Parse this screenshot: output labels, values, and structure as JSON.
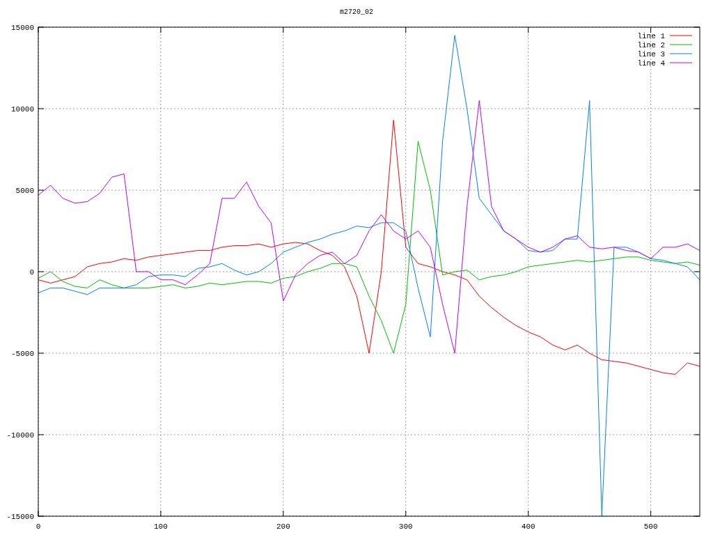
{
  "chart": {
    "chart_data": {
      "type": "line",
      "title": "m2720_02",
      "x": [
        0,
        10,
        20,
        30,
        40,
        50,
        60,
        70,
        80,
        90,
        100,
        110,
        120,
        130,
        140,
        150,
        160,
        170,
        180,
        190,
        200,
        210,
        220,
        230,
        240,
        250,
        260,
        270,
        280,
        290,
        300,
        310,
        320,
        330,
        340,
        350,
        360,
        370,
        380,
        390,
        400,
        410,
        420,
        430,
        440,
        450,
        460,
        470,
        480,
        490,
        500,
        510,
        520,
        530,
        540
      ],
      "series": [
        {
          "name": "line 1",
          "color": "#ff0000",
          "values": [
            -500,
            -700,
            -500,
            -300,
            300,
            500,
            600,
            800,
            700,
            900,
            1000,
            1100,
            1200,
            1300,
            1300,
            1500,
            1600,
            1600,
            1700,
            1500,
            1700,
            1800,
            1700,
            1300,
            1000,
            300,
            -1500,
            -5000,
            0,
            9300,
            1500,
            500,
            300,
            0,
            -200,
            -500,
            -1500,
            -2200,
            -2800,
            -3300,
            -3700,
            -4000,
            -4500,
            -4800,
            -4500,
            -5000,
            -5400,
            -5500,
            -5600,
            -5800,
            -6000,
            -6200,
            -6300,
            -5600,
            -5800
          ]
        },
        {
          "name": "line 2",
          "color": "#00c000",
          "values": [
            -400,
            0,
            -600,
            -900,
            -1000,
            -500,
            -800,
            -1000,
            -1000,
            -1000,
            -900,
            -800,
            -1000,
            -900,
            -700,
            -800,
            -700,
            -600,
            -600,
            -700,
            -400,
            -300,
            0,
            200,
            500,
            500,
            300,
            -1500,
            -3000,
            -5000,
            -2000,
            8000,
            5000,
            -200,
            0,
            100,
            -500,
            -300,
            -200,
            0,
            300,
            400,
            500,
            600,
            700,
            600,
            700,
            800,
            900,
            900,
            700,
            600,
            500,
            600,
            400
          ]
        },
        {
          "name": "line 3",
          "color": "#0080ff",
          "values": [
            -1300,
            -1000,
            -1000,
            -1200,
            -1400,
            -1000,
            -1000,
            -1000,
            -800,
            -300,
            -200,
            -200,
            -300,
            200,
            300,
            500,
            100,
            -200,
            0,
            500,
            1200,
            1500,
            1800,
            2000,
            2300,
            2500,
            2800,
            2700,
            3000,
            3000,
            2500,
            -1000,
            -4000,
            8000,
            14500,
            10000,
            4500,
            3500,
            2500,
            2000,
            1300,
            1200,
            1300,
            2000,
            2000,
            10500,
            -15000,
            1500,
            1500,
            1200,
            800,
            700,
            500,
            300,
            -500
          ]
        },
        {
          "name": "line 4",
          "color": "#c000ff",
          "values": [
            4700,
            5300,
            4500,
            4200,
            4300,
            4800,
            5800,
            6000,
            0,
            0,
            -500,
            -500,
            -800,
            -200,
            500,
            4500,
            4500,
            5500,
            4000,
            3000,
            -1800,
            -200,
            500,
            1000,
            1200,
            500,
            1000,
            2500,
            3500,
            2500,
            2000,
            2500,
            1500,
            -2000,
            -5000,
            4000,
            10500,
            4000,
            2500,
            2000,
            1500,
            1200,
            1500,
            2000,
            2200,
            1500,
            1400,
            1500,
            1300,
            1200,
            800,
            1500,
            1500,
            1700,
            1300
          ]
        }
      ],
      "xlim": [
        0,
        540
      ],
      "ylim": [
        -15000,
        15000
      ],
      "xticks": [
        0,
        100,
        200,
        300,
        400,
        500
      ],
      "yticks": [
        -15000,
        -10000,
        -5000,
        0,
        5000,
        10000,
        15000
      ],
      "grid": true,
      "legend": true
    }
  }
}
